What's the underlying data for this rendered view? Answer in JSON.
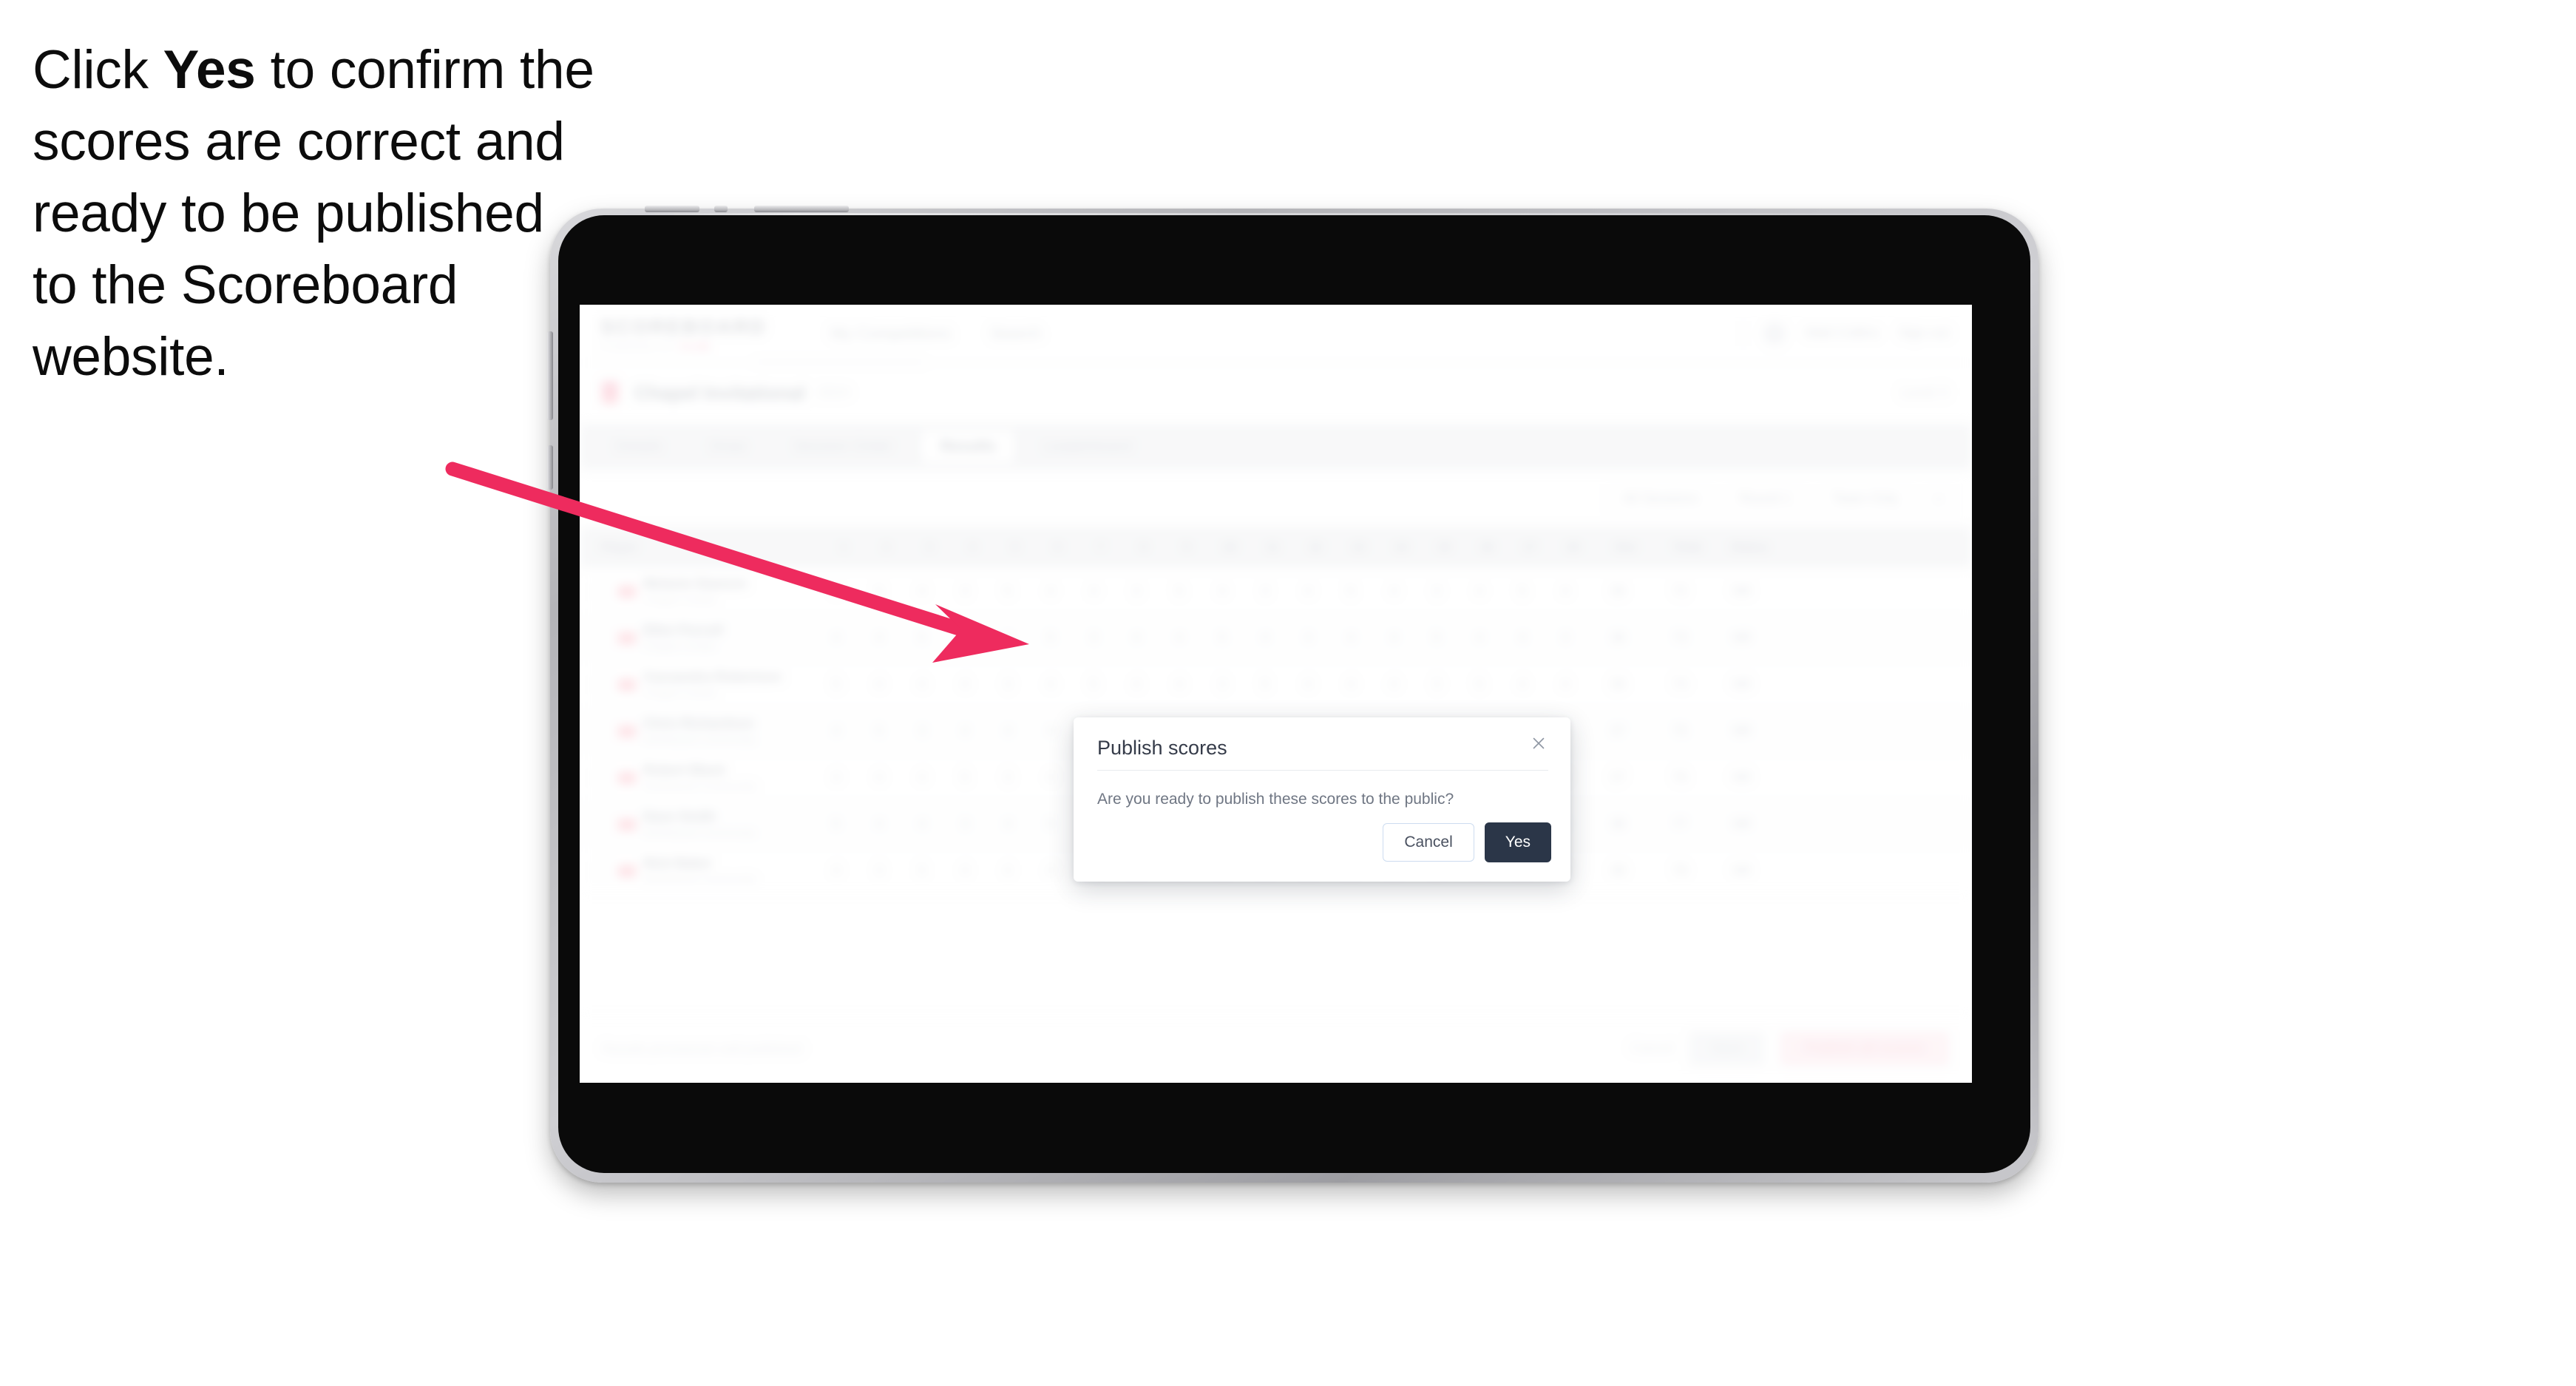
{
  "caption": {
    "before": "Click ",
    "bold": "Yes",
    "after": " to confirm the scores are correct and ready to be published to the Scoreboard website."
  },
  "colors": {
    "accent_pink": "#ef2c5f",
    "arrow_pink": "#ee2b5e",
    "modal_primary": "#2b3648",
    "cancel_border": "#cddcf0",
    "device_black": "#0a0a0a",
    "device_rim": "#b4b4b8"
  },
  "app": {
    "brand": {
      "name": "SCOREBOARD",
      "sub": "POWERED BY",
      "sub_accent": "CLUB"
    },
    "nav": [
      {
        "label": "My Competitions",
        "active": false
      },
      {
        "label": "Search",
        "active": false
      }
    ],
    "header_right": {
      "avatar": "avatar-icon",
      "user": "Matt Collins",
      "menu": "Sign out"
    },
    "competition": {
      "title": "Chapel Invitational",
      "meta": "2024",
      "right": "Level 3",
      "flag": "flag-icon"
    },
    "tabs": [
      {
        "label": "Details",
        "active": false
      },
      {
        "label": "Draw",
        "active": false
      },
      {
        "label": "Session Order",
        "active": false
      },
      {
        "label": "Results",
        "active": true
      },
      {
        "label": "Leaderboard",
        "active": false
      }
    ],
    "filters": [
      {
        "label": "All Sessions",
        "icon": "chevron-down-icon"
      },
      {
        "label": "Round 1",
        "icon": "chevron-down-icon"
      },
      {
        "label": "Team Only",
        "icon": "chevron-down-icon"
      },
      {
        "label": "x",
        "icon": "close-icon"
      }
    ],
    "table": {
      "columns": [
        "Player",
        "1",
        "2",
        "3",
        "4",
        "5",
        "6",
        "7",
        "8",
        "9",
        "10",
        "11",
        "12",
        "13",
        "14",
        "15",
        "16",
        "17",
        "18",
        "19",
        "20",
        "Out",
        "Total",
        "Status"
      ],
      "rows": [
        {
          "flag": "flag-icon",
          "name": "Melanie Dawson",
          "club": "Chapel Cricket",
          "scores": [
            "4",
            "5",
            "4",
            "3",
            "5",
            "4",
            "4",
            "3",
            "5",
            "4",
            "3",
            "4",
            "5",
            "4",
            "3",
            "4",
            "5",
            "4"
          ],
          "out": "36",
          "total": "72",
          "status": "NR"
        },
        {
          "flag": "flag-icon",
          "name": "Ellen Purcell",
          "club": "Chapel Cricket",
          "scores": [
            "4",
            "4",
            "5",
            "4",
            "4",
            "5",
            "3",
            "4",
            "4",
            "5",
            "4",
            "3",
            "4",
            "4",
            "5",
            "4",
            "4",
            "3"
          ],
          "out": "36",
          "total": "73",
          "status": "NR"
        },
        {
          "flag": "flag-icon",
          "name": "Cassandra Robertson",
          "club": "Chapel Cricket",
          "scores": [
            "5",
            "4",
            "4",
            "4",
            "3",
            "4",
            "5",
            "4",
            "4",
            "3",
            "5",
            "4",
            "4",
            "4",
            "3",
            "5",
            "4",
            "4"
          ],
          "out": "36",
          "total": "74",
          "status": "NR"
        },
        {
          "flag": "flag-icon",
          "name": "Chris Richardson",
          "club": "Northwood Community",
          "scores": [
            "4",
            "5",
            "3",
            "4",
            "4",
            "4",
            "5",
            "4",
            "3",
            "4",
            "4",
            "5",
            "4",
            "3",
            "4",
            "4",
            "5",
            "4"
          ],
          "out": "37",
          "total": "75",
          "status": "NR"
        },
        {
          "flag": "flag-icon",
          "name": "Robert Black",
          "club": "Northwood Community",
          "scores": [
            "4",
            "4",
            "4",
            "5",
            "3",
            "4",
            "4",
            "4",
            "5",
            "3",
            "4",
            "4",
            "4",
            "5",
            "3",
            "4",
            "4",
            "4"
          ],
          "out": "37",
          "total": "76",
          "status": "NR"
        },
        {
          "flag": "flag-icon",
          "name": "Dave Smith",
          "club": "Northwood Community",
          "scores": [
            "5",
            "4",
            "4",
            "3",
            "4",
            "5",
            "4",
            "4",
            "3",
            "4",
            "5",
            "4",
            "4",
            "3",
            "4",
            "5",
            "4",
            "4"
          ],
          "out": "38",
          "total": "77",
          "status": "NR"
        },
        {
          "flag": "flag-icon",
          "name": "Nick Baker",
          "club": "Northwood Community",
          "scores": [
            "4",
            "3",
            "5",
            "4",
            "4",
            "4",
            "3",
            "5",
            "4",
            "4",
            "4",
            "3",
            "5",
            "4",
            "4",
            "4",
            "3",
            "5"
          ],
          "out": "38",
          "total": "78",
          "status": "NR"
        }
      ]
    },
    "bottom": {
      "note": "Results provisional until published",
      "link": "Cancel",
      "save": "Save",
      "publish": "Publish all scores"
    }
  },
  "modal": {
    "title": "Publish scores",
    "close_icon": "close-icon",
    "message": "Are you ready to publish these scores to the public?",
    "cancel_label": "Cancel",
    "confirm_label": "Yes"
  }
}
